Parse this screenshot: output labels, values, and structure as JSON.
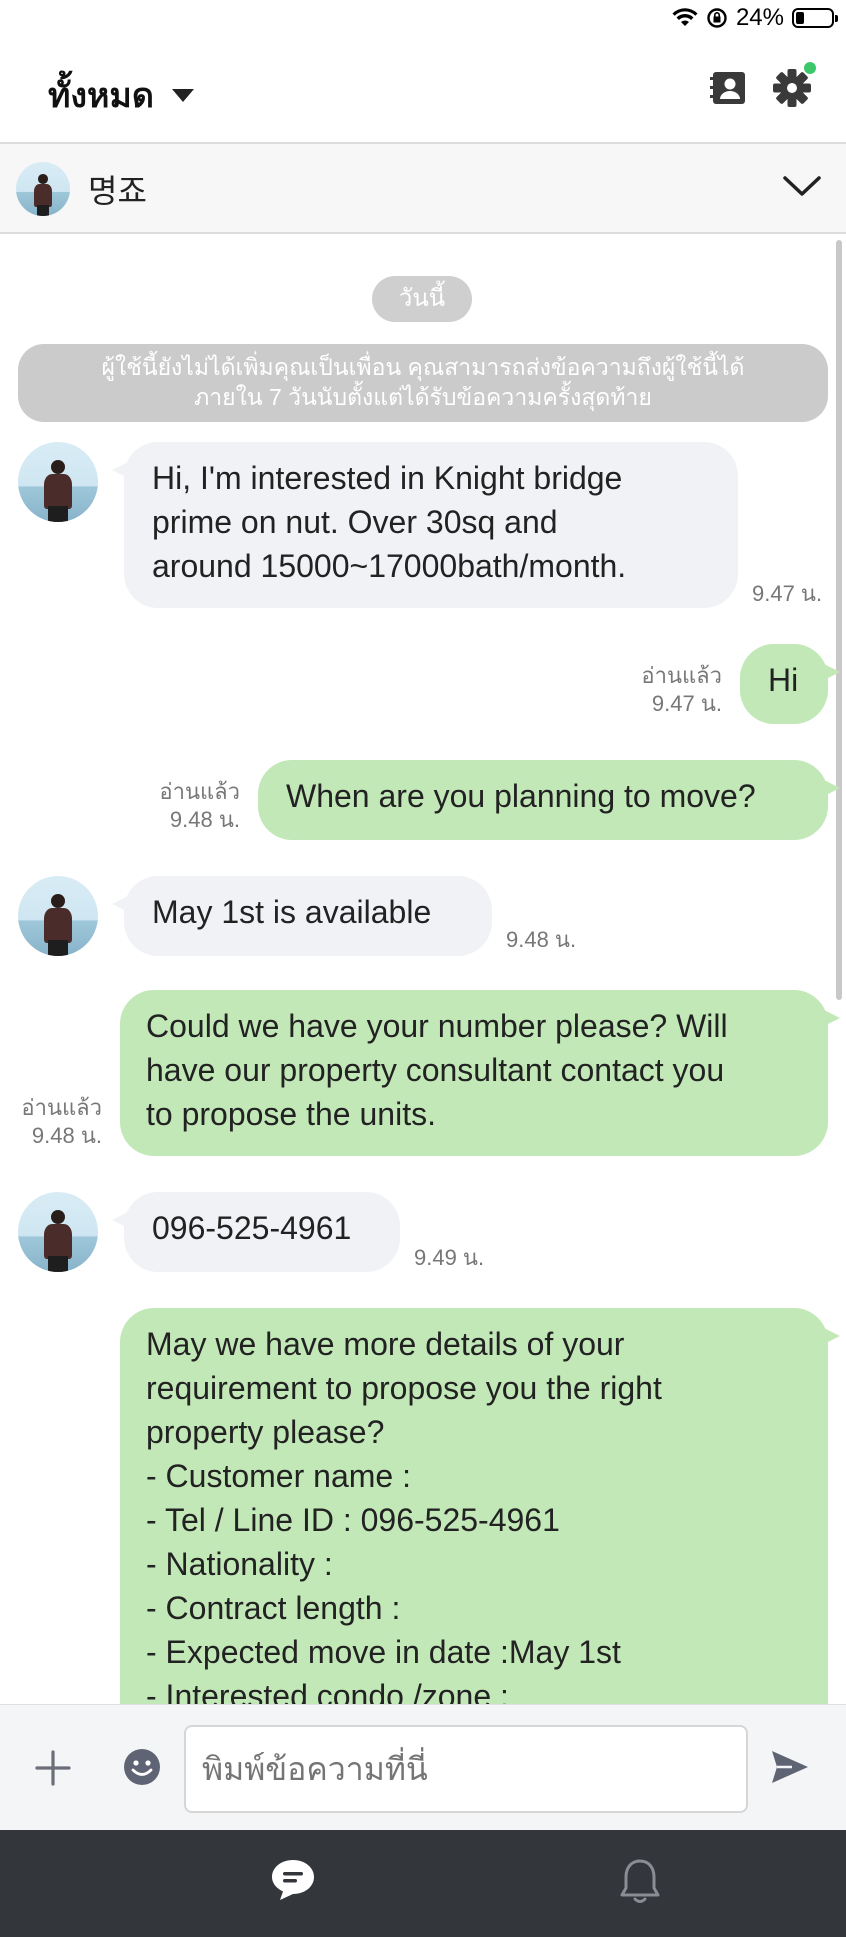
{
  "status": {
    "battery": "24%",
    "battery_level": 0.24
  },
  "header": {
    "title": "ทั้งหมด"
  },
  "chat": {
    "name": "명죠"
  },
  "date_divider": "วันนี้",
  "notice": {
    "line1": "ผู้ใช้นี้ยังไม่ได้เพิ่มคุณเป็นเพื่อน คุณสามารถส่งข้อความถึงผู้ใช้นี้ได้",
    "line2": "ภายใน 7 วันนับตั้งแต่ได้รับข้อความครั้งสุดท้าย"
  },
  "messages": [
    {
      "dir": "in",
      "text": "Hi, I'm interested in Knight bridge\nprime on nut. Over 30sq and\naround 15000~17000bath/month.",
      "time": "9.47 น."
    },
    {
      "dir": "out",
      "text": "Hi",
      "read": "อ่านแล้ว",
      "time": "9.47 น."
    },
    {
      "dir": "out",
      "text": "When are you planning to move?",
      "read": "อ่านแล้ว",
      "time": "9.48 น."
    },
    {
      "dir": "in",
      "text": "May 1st is available",
      "time": "9.48 น."
    },
    {
      "dir": "out",
      "text": "Could we have your number please? Will\nhave our property consultant contact you\nto propose the units.",
      "read": "อ่านแล้ว",
      "time": "9.48 น."
    },
    {
      "dir": "in",
      "text": "096-525-4961",
      "time": "9.49 น."
    },
    {
      "dir": "out",
      "text": "May we have more details of your\nrequirement to propose you the right\nproperty please?\n- Customer name :\n- Tel / Line ID : 096-525-4961\n- Nationality :\n- Contract length :\n- Expected move in date :May 1st\n- Interested condo /zone :"
    }
  ],
  "input": {
    "placeholder": "พิมพ์ข้อความที่นี่"
  },
  "icons": {
    "wifi": "wifi-icon",
    "rotation_lock": "rotation-lock-icon",
    "battery": "battery-icon",
    "contacts": "contact-card-icon",
    "settings": "gear-icon",
    "collapse": "chevron-down-icon",
    "add": "plus-icon",
    "emoji": "emoji-icon",
    "send": "send-icon",
    "chats": "chat-bubble-icon",
    "notifications": "bell-icon"
  },
  "colors": {
    "outgoing_bubble": "#c2e8b8",
    "incoming_bubble": "#f1f2f6",
    "notice": "#cbcbcb",
    "nav_bar": "#33363b",
    "settings_badge": "#3cc76b"
  }
}
